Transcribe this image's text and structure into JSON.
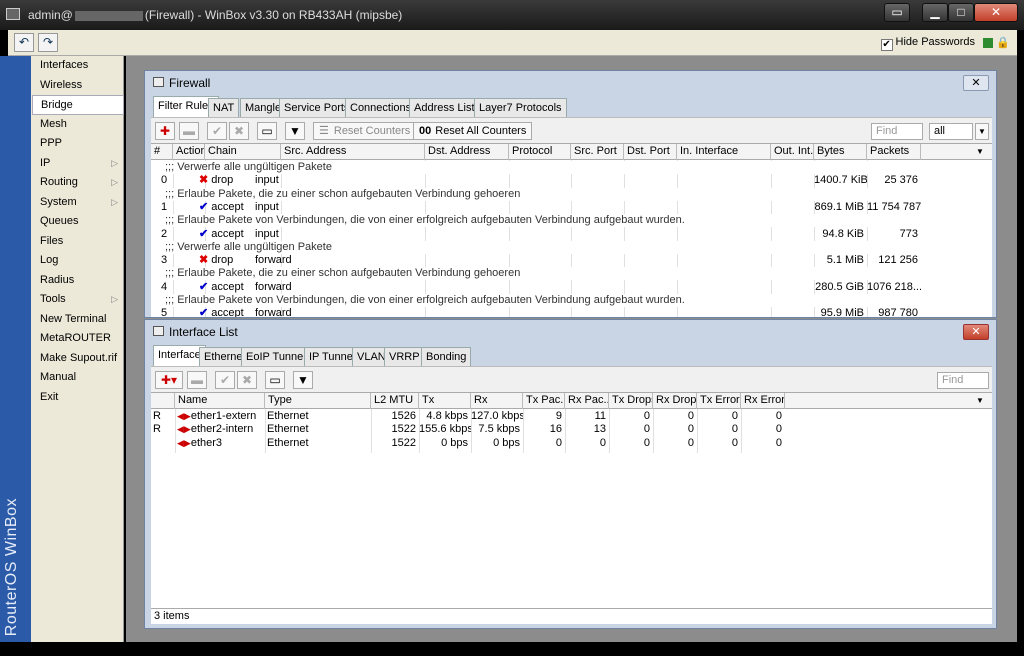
{
  "window": {
    "title_prefix": "admin@",
    "title_suffix": "(Firewall) - WinBox v3.30 on RB433AH (mipsbe)",
    "min": "▁",
    "max": "□",
    "close": "✕"
  },
  "toolbar": {
    "undo": "↶",
    "redo": "↷",
    "hide_passwords": "Hide Passwords",
    "hide_passwords_checked": "✔"
  },
  "sidebar": {
    "brand": "RouterOS WinBox",
    "items": [
      {
        "label": "Interfaces",
        "arrow": ""
      },
      {
        "label": "Wireless",
        "arrow": ""
      },
      {
        "label": "Bridge",
        "arrow": ""
      },
      {
        "label": "Mesh",
        "arrow": ""
      },
      {
        "label": "PPP",
        "arrow": ""
      },
      {
        "label": "IP",
        "arrow": "▷"
      },
      {
        "label": "Routing",
        "arrow": "▷"
      },
      {
        "label": "System",
        "arrow": "▷"
      },
      {
        "label": "Queues",
        "arrow": ""
      },
      {
        "label": "Files",
        "arrow": ""
      },
      {
        "label": "Log",
        "arrow": ""
      },
      {
        "label": "Radius",
        "arrow": ""
      },
      {
        "label": "Tools",
        "arrow": "▷"
      },
      {
        "label": "New Terminal",
        "arrow": ""
      },
      {
        "label": "MetaROUTER",
        "arrow": ""
      },
      {
        "label": "Make Supout.rif",
        "arrow": ""
      },
      {
        "label": "Manual",
        "arrow": ""
      },
      {
        "label": "Exit",
        "arrow": ""
      }
    ]
  },
  "firewall": {
    "title": "Firewall",
    "close": "✕",
    "tabs": [
      "Filter Rules",
      "NAT",
      "Mangle",
      "Service Ports",
      "Connections",
      "Address Lists",
      "Layer7 Protocols"
    ],
    "buttons": {
      "add": "✚",
      "remove": "▬",
      "enable": "✔",
      "disable": "✖",
      "comment": "▭",
      "filter": "▼",
      "reset_counters": "Reset Counters",
      "reset_all_counters": "Reset All Counters",
      "reset_all_prefix": "00"
    },
    "find_placeholder": "Find",
    "filter_value": "all",
    "dropdown": "▼",
    "columns": [
      "#",
      "Action",
      "Chain",
      "Src. Address",
      "Dst. Address",
      "Protocol",
      "Src. Port",
      "Dst. Port",
      "In. Interface",
      "Out. Int...",
      "Bytes",
      "Packets"
    ],
    "rules": [
      {
        "comment": ";;; Verwerfe alle ungültigen Pakete",
        "num": "0",
        "action": "drop",
        "chain": "input",
        "bytes": "1400.7 KiB",
        "packets": "25 376"
      },
      {
        "comment": ";;; Erlaube Pakete, die zu einer schon aufgebauten Verbindung gehoeren",
        "num": "1",
        "action": "accept",
        "chain": "input",
        "bytes": "869.1 MiB",
        "packets": "11 754 787"
      },
      {
        "comment": ";;; Erlaube Pakete von Verbindungen, die von einer erfolgreich aufgebauten Verbindung aufgebaut wurden.",
        "num": "2",
        "action": "accept",
        "chain": "input",
        "bytes": "94.8 KiB",
        "packets": "773"
      },
      {
        "comment": ";;; Verwerfe alle ungültigen Pakete",
        "num": "3",
        "action": "drop",
        "chain": "forward",
        "bytes": "5.1 MiB",
        "packets": "121 256"
      },
      {
        "comment": ";;; Erlaube Pakete, die zu einer schon aufgebauten Verbindung gehoeren",
        "num": "4",
        "action": "accept",
        "chain": "forward",
        "bytes": "280.5 GiB",
        "packets": "1076 218..."
      },
      {
        "comment": ";;; Erlaube Pakete von Verbindungen, die von einer erfolgreich aufgebauten Verbindung aufgebaut wurden.",
        "num": "5",
        "action": "accept",
        "chain": "forward",
        "bytes": "95.9 MiB",
        "packets": "987 780"
      }
    ]
  },
  "iflist": {
    "title": "Interface List",
    "close": "✕",
    "tabs": [
      "Interface",
      "Ethernet",
      "EoIP Tunnel",
      "IP Tunnel",
      "VLAN",
      "VRRP",
      "Bonding"
    ],
    "find_placeholder": "Find",
    "columns": [
      "Name",
      "Type",
      "L2 MTU",
      "Tx",
      "Rx",
      "Tx Pac...",
      "Rx Pac...",
      "Tx Drops",
      "Rx Drops",
      "Tx Errors",
      "Rx Errors"
    ],
    "rows": [
      {
        "flag": "R",
        "name": "ether1-extern",
        "type": "Ethernet",
        "mtu": "1526",
        "tx": "4.8 kbps",
        "rx": "127.0 kbps",
        "txp": "9",
        "rxp": "11",
        "txd": "0",
        "rxd": "0",
        "txe": "0",
        "rxe": "0"
      },
      {
        "flag": "R",
        "name": "ether2-intern",
        "type": "Ethernet",
        "mtu": "1522",
        "tx": "155.6 kbps",
        "rx": "7.5 kbps",
        "txp": "16",
        "rxp": "13",
        "txd": "0",
        "rxd": "0",
        "txe": "0",
        "rxe": "0"
      },
      {
        "flag": "",
        "name": "ether3",
        "type": "Ethernet",
        "mtu": "1522",
        "tx": "0 bps",
        "rx": "0 bps",
        "txp": "0",
        "rxp": "0",
        "txd": "0",
        "rxd": "0",
        "txe": "0",
        "rxe": "0"
      }
    ],
    "status": "3 items"
  }
}
